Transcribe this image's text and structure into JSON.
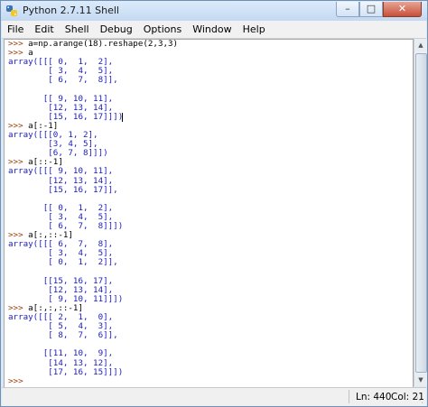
{
  "window": {
    "title": "Python 2.7.11 Shell"
  },
  "menu": [
    "File",
    "Edit",
    "Shell",
    "Debug",
    "Options",
    "Window",
    "Help"
  ],
  "lines": [
    {
      "prompt": ">>> ",
      "text": "a=np.arange(18).reshape(2,3,3)"
    },
    {
      "prompt": ">>> ",
      "text": "a"
    },
    {
      "text": "array([[[ 0,  1,  2],"
    },
    {
      "text": "        [ 3,  4,  5],"
    },
    {
      "text": "        [ 6,  7,  8]],"
    },
    {
      "text": ""
    },
    {
      "text": "       [[ 9, 10, 11],"
    },
    {
      "text": "        [12, 13, 14],"
    },
    {
      "text": "        [15, 16, 17]]])"
    },
    {
      "prompt": ">>> ",
      "text": "a[:-1]"
    },
    {
      "text": "array([[[0, 1, 2],"
    },
    {
      "text": "        [3, 4, 5],"
    },
    {
      "text": "        [6, 7, 8]]])"
    },
    {
      "prompt": ">>> ",
      "text": "a[::-1]"
    },
    {
      "text": "array([[[ 9, 10, 11],"
    },
    {
      "text": "        [12, 13, 14],"
    },
    {
      "text": "        [15, 16, 17]],"
    },
    {
      "text": ""
    },
    {
      "text": "       [[ 0,  1,  2],"
    },
    {
      "text": "        [ 3,  4,  5],"
    },
    {
      "text": "        [ 6,  7,  8]]])"
    },
    {
      "prompt": ">>> ",
      "text": "a[:,::-1]"
    },
    {
      "text": "array([[[ 6,  7,  8],"
    },
    {
      "text": "        [ 3,  4,  5],"
    },
    {
      "text": "        [ 0,  1,  2]],"
    },
    {
      "text": ""
    },
    {
      "text": "       [[15, 16, 17],"
    },
    {
      "text": "        [12, 13, 14],"
    },
    {
      "text": "        [ 9, 10, 11]]])"
    },
    {
      "prompt": ">>> ",
      "text": "a[:,:,::-1]"
    },
    {
      "text": "array([[[ 2,  1,  0],"
    },
    {
      "text": "        [ 5,  4,  3],"
    },
    {
      "text": "        [ 8,  7,  6]],"
    },
    {
      "text": ""
    },
    {
      "text": "       [[11, 10,  9],"
    },
    {
      "text": "        [14, 13, 12],"
    },
    {
      "text": "        [17, 16, 15]]])"
    },
    {
      "prompt": ">>> ",
      "text": ""
    }
  ],
  "status": {
    "ln": "Ln: 440",
    "col": "Col: 21"
  },
  "colors": {
    "prompt": "#9d3a00",
    "output": "#1a1ac0",
    "code": "#000000"
  }
}
